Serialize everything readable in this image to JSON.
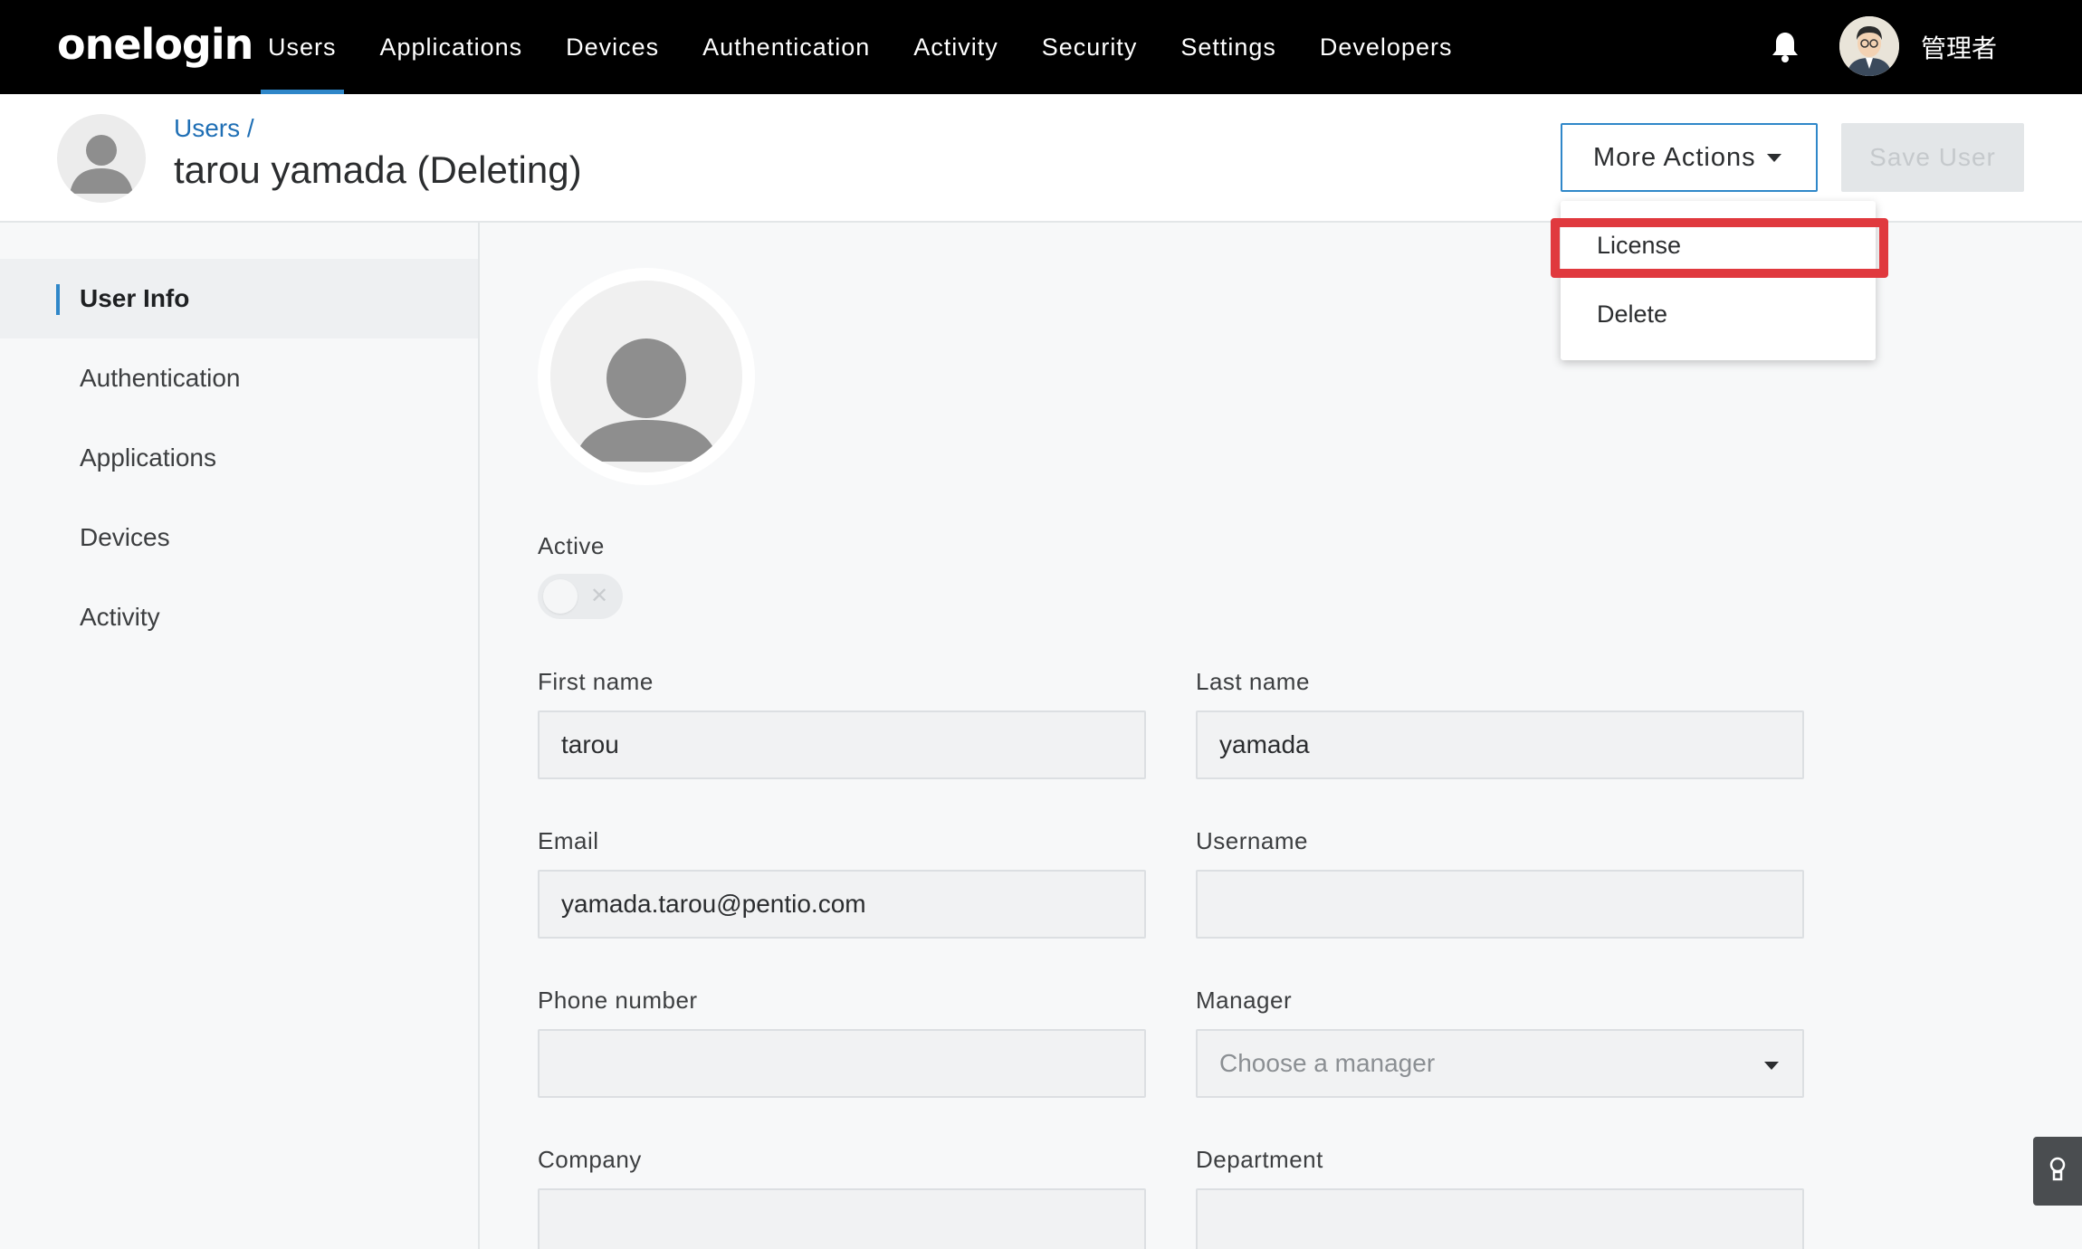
{
  "nav": {
    "logo": "onelogin",
    "links": [
      "Users",
      "Applications",
      "Devices",
      "Authentication",
      "Activity",
      "Security",
      "Settings",
      "Developers"
    ],
    "active": "Users",
    "admin_name": "管理者"
  },
  "header": {
    "breadcrumb": "Users /",
    "title": "tarou yamada (Deleting)",
    "more_actions": "More Actions",
    "save_user": "Save User"
  },
  "dropdown": {
    "items": [
      "License",
      "Delete"
    ],
    "highlighted": "License"
  },
  "sidebar": {
    "items": [
      "User Info",
      "Authentication",
      "Applications",
      "Devices",
      "Activity"
    ],
    "active": "User Info"
  },
  "form": {
    "active_label": "Active",
    "active_value": false,
    "first_name_label": "First name",
    "first_name_value": "tarou",
    "last_name_label": "Last name",
    "last_name_value": "yamada",
    "email_label": "Email",
    "email_value": "yamada.tarou@pentio.com",
    "username_label": "Username",
    "username_value": "",
    "phone_label": "Phone number",
    "phone_value": "",
    "manager_label": "Manager",
    "manager_placeholder": "Choose a manager",
    "company_label": "Company",
    "company_value": "",
    "department_label": "Department",
    "department_value": ""
  },
  "colors": {
    "accent": "#2f87c9",
    "highlight": "#e0393e",
    "nav_bg": "#000000"
  },
  "icons": [
    "bell-icon",
    "avatar",
    "chevron-down-icon",
    "lightbulb-icon"
  ]
}
